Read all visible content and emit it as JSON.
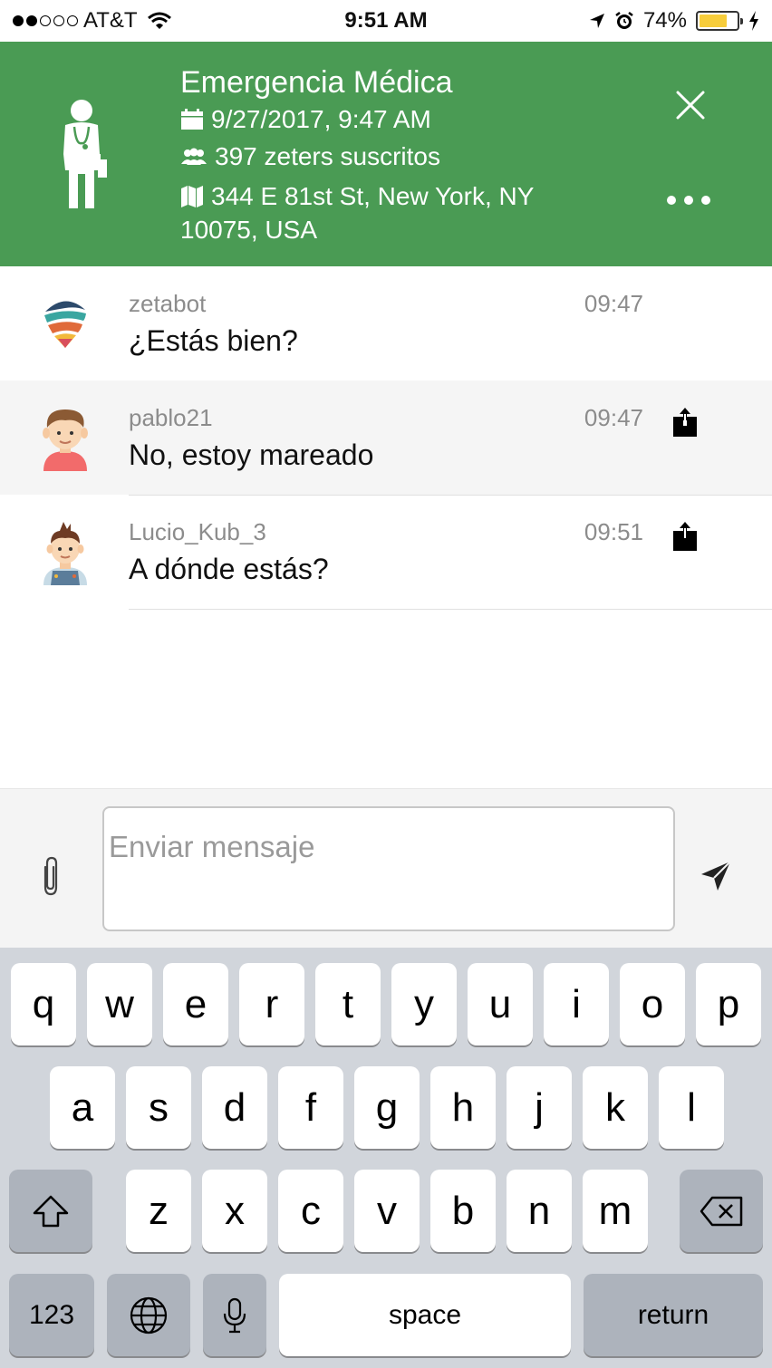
{
  "status_bar": {
    "carrier": "AT&T",
    "time": "9:51 AM",
    "battery": "74%",
    "battery_level": 0.74
  },
  "header": {
    "title": "Emergencia Médica",
    "date": "9/27/2017, 9:47 AM",
    "subscribers": "397 zeters suscritos",
    "address": "344 E 81st St, New York, NY 10075, USA",
    "close_icon": "close-icon",
    "more_icon": "more-icon"
  },
  "messages": [
    {
      "user": "zetabot",
      "time": "09:47",
      "text": "¿Estás bien?",
      "avatar": "zetabot-logo"
    },
    {
      "user": "pablo21",
      "time": "09:47",
      "text": "No, estoy mareado",
      "avatar": "boy-avatar"
    },
    {
      "user": "Lucio_Kub_3",
      "time": "09:51",
      "text": "A dónde estás?",
      "avatar": "boy-overalls-avatar"
    }
  ],
  "composer": {
    "placeholder": "Enviar mensaje"
  },
  "keyboard": {
    "row1": [
      "q",
      "w",
      "e",
      "r",
      "t",
      "y",
      "u",
      "i",
      "o",
      "p"
    ],
    "row2": [
      "a",
      "s",
      "d",
      "f",
      "g",
      "h",
      "j",
      "k",
      "l"
    ],
    "row3": [
      "z",
      "x",
      "c",
      "v",
      "b",
      "n",
      "m"
    ],
    "numbers": "123",
    "space": "space",
    "return": "return"
  },
  "colors": {
    "header_bg": "#4a9b54",
    "battery": "#f7cd3b",
    "keyboard_bg": "#d1d5db"
  }
}
